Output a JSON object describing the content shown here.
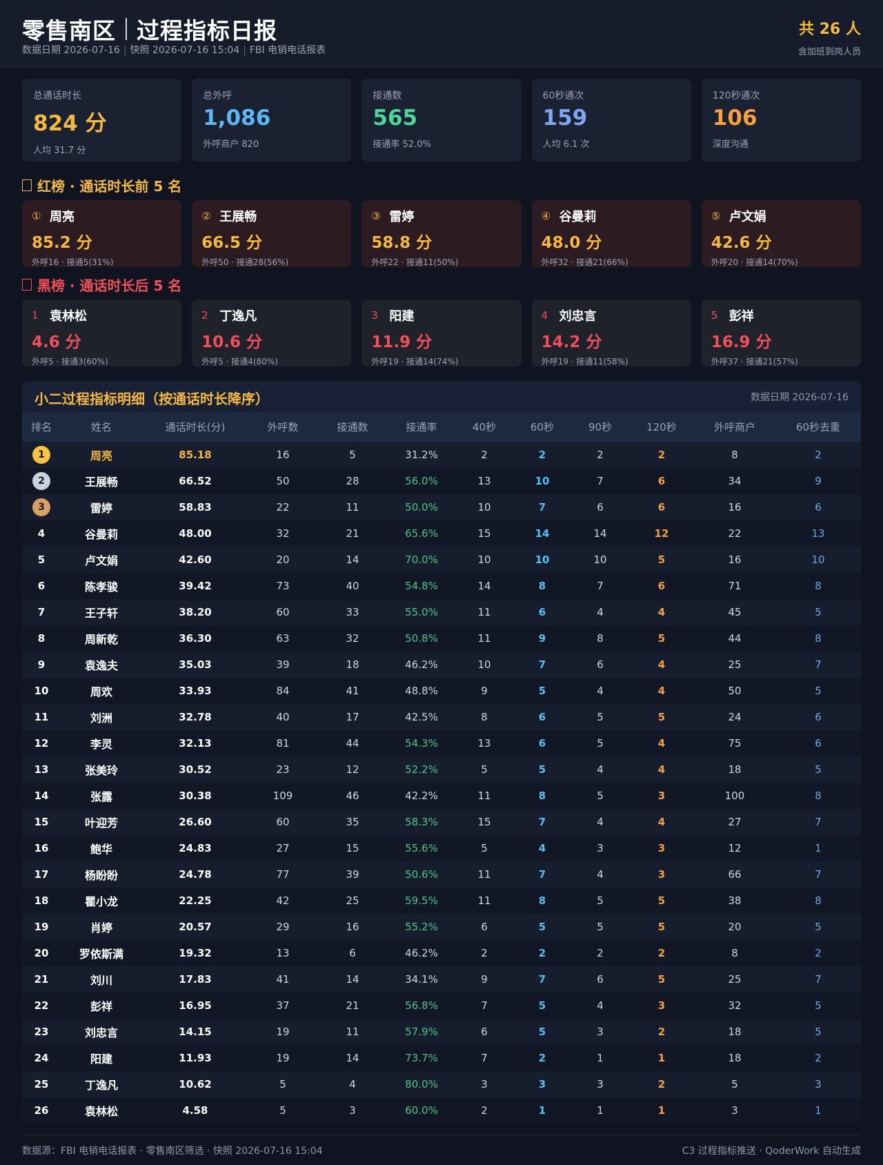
{
  "header": {
    "title_region": "零售南区",
    "title_report": "过程指标日报",
    "subtitle_parts": [
      "数据日期 2026-07-16",
      "快照 2026-07-16 15:04",
      "FBI 电销电话报表"
    ],
    "count": "共 26 人",
    "count_note": "含加班到岗人员"
  },
  "kpis": [
    {
      "label": "总通话时长",
      "value": "824 分",
      "sub": "人均 31.7 分",
      "color": "#f5b93f"
    },
    {
      "label": "总外呼",
      "value": "1,086",
      "sub": "外呼商户 820",
      "color": "#5cb8f5"
    },
    {
      "label": "接通数",
      "value": "565",
      "sub": "接通率 52.0%",
      "color": "#4cd69a"
    },
    {
      "label": "60秒通次",
      "value": "159",
      "sub": "人均 6.1 次",
      "color": "#7fa6f0"
    },
    {
      "label": "120秒通次",
      "value": "106",
      "sub": "深度沟通",
      "color": "#f5a13f"
    }
  ],
  "red_board": {
    "title": "红榜 · 通话时长前 5 名",
    "color": "#f5b93f",
    "items": [
      {
        "num": "①",
        "name": "周亮",
        "value": "85.2 分",
        "sub": "外呼16 · 接通5(31%)"
      },
      {
        "num": "②",
        "name": "王展畅",
        "value": "66.5 分",
        "sub": "外呼50 · 接通28(56%)"
      },
      {
        "num": "③",
        "name": "雷婷",
        "value": "58.8 分",
        "sub": "外呼22 · 接通11(50%)"
      },
      {
        "num": "④",
        "name": "谷曼莉",
        "value": "48.0 分",
        "sub": "外呼32 · 接通21(66%)"
      },
      {
        "num": "⑤",
        "name": "卢文娟",
        "value": "42.6 分",
        "sub": "外呼20 · 接通14(70%)"
      }
    ]
  },
  "black_board": {
    "title": "黑榜 · 通话时长后 5 名",
    "color": "#f0505a",
    "items": [
      {
        "num": "1",
        "name": "袁林松",
        "value": "4.6 分",
        "sub": "外呼5 · 接通3(60%)"
      },
      {
        "num": "2",
        "name": "丁逸凡",
        "value": "10.6 分",
        "sub": "外呼5 · 接通4(80%)"
      },
      {
        "num": "3",
        "name": "阳建",
        "value": "11.9 分",
        "sub": "外呼19 · 接通14(74%)"
      },
      {
        "num": "4",
        "name": "刘忠言",
        "value": "14.2 分",
        "sub": "外呼19 · 接通11(58%)"
      },
      {
        "num": "5",
        "name": "彭祥",
        "value": "16.9 分",
        "sub": "外呼37 · 接通21(57%)"
      }
    ]
  },
  "table": {
    "title": "小二过程指标明细（按通话时长降序）",
    "date": "数据日期 2026-07-16",
    "medal_colors": [
      "#f5c242",
      "#c9d3de",
      "#d9a066"
    ],
    "columns": [
      "排名",
      "姓名",
      "通话时长(分)",
      "外呼数",
      "接通数",
      "接通率",
      "40秒",
      "60秒",
      "90秒",
      "120秒",
      "外呼商户",
      "60秒去重"
    ],
    "rows": [
      [
        "1",
        "周亮",
        "85.18",
        "16",
        "5",
        "31.2%",
        "2",
        "2",
        "2",
        "2",
        "8",
        "2"
      ],
      [
        "2",
        "王展畅",
        "66.52",
        "50",
        "28",
        "56.0%",
        "13",
        "10",
        "7",
        "6",
        "34",
        "9"
      ],
      [
        "3",
        "雷婷",
        "58.83",
        "22",
        "11",
        "50.0%",
        "10",
        "7",
        "6",
        "6",
        "16",
        "6"
      ],
      [
        "4",
        "谷曼莉",
        "48.00",
        "32",
        "21",
        "65.6%",
        "15",
        "14",
        "14",
        "12",
        "22",
        "13"
      ],
      [
        "5",
        "卢文娟",
        "42.60",
        "20",
        "14",
        "70.0%",
        "10",
        "10",
        "10",
        "5",
        "16",
        "10"
      ],
      [
        "6",
        "陈孝骏",
        "39.42",
        "73",
        "40",
        "54.8%",
        "14",
        "8",
        "7",
        "6",
        "71",
        "8"
      ],
      [
        "7",
        "王子轩",
        "38.20",
        "60",
        "33",
        "55.0%",
        "11",
        "6",
        "4",
        "4",
        "45",
        "5"
      ],
      [
        "8",
        "周新乾",
        "36.30",
        "63",
        "32",
        "50.8%",
        "11",
        "9",
        "8",
        "5",
        "44",
        "8"
      ],
      [
        "9",
        "袁逸夫",
        "35.03",
        "39",
        "18",
        "46.2%",
        "10",
        "7",
        "6",
        "4",
        "25",
        "7"
      ],
      [
        "10",
        "周欢",
        "33.93",
        "84",
        "41",
        "48.8%",
        "9",
        "5",
        "4",
        "4",
        "50",
        "5"
      ],
      [
        "11",
        "刘洲",
        "32.78",
        "40",
        "17",
        "42.5%",
        "8",
        "6",
        "5",
        "5",
        "24",
        "6"
      ],
      [
        "12",
        "李灵",
        "32.13",
        "81",
        "44",
        "54.3%",
        "13",
        "6",
        "5",
        "4",
        "75",
        "6"
      ],
      [
        "13",
        "张美玲",
        "30.52",
        "23",
        "12",
        "52.2%",
        "5",
        "5",
        "4",
        "4",
        "18",
        "5"
      ],
      [
        "14",
        "张露",
        "30.38",
        "109",
        "46",
        "42.2%",
        "11",
        "8",
        "5",
        "3",
        "100",
        "8"
      ],
      [
        "15",
        "叶迎芳",
        "26.60",
        "60",
        "35",
        "58.3%",
        "15",
        "7",
        "4",
        "4",
        "27",
        "7"
      ],
      [
        "16",
        "鲍华",
        "24.83",
        "27",
        "15",
        "55.6%",
        "5",
        "4",
        "3",
        "3",
        "12",
        "1"
      ],
      [
        "17",
        "杨盼盼",
        "24.78",
        "77",
        "39",
        "50.6%",
        "11",
        "7",
        "4",
        "3",
        "66",
        "7"
      ],
      [
        "18",
        "瞿小龙",
        "22.25",
        "42",
        "25",
        "59.5%",
        "11",
        "8",
        "5",
        "5",
        "38",
        "8"
      ],
      [
        "19",
        "肖婷",
        "20.57",
        "29",
        "16",
        "55.2%",
        "6",
        "5",
        "5",
        "5",
        "20",
        "5"
      ],
      [
        "20",
        "罗依斯满",
        "19.32",
        "13",
        "6",
        "46.2%",
        "2",
        "2",
        "2",
        "2",
        "8",
        "2"
      ],
      [
        "21",
        "刘川",
        "17.83",
        "41",
        "14",
        "34.1%",
        "9",
        "7",
        "6",
        "5",
        "25",
        "7"
      ],
      [
        "22",
        "彭祥",
        "16.95",
        "37",
        "21",
        "56.8%",
        "7",
        "5",
        "4",
        "3",
        "32",
        "5"
      ],
      [
        "23",
        "刘忠言",
        "14.15",
        "19",
        "11",
        "57.9%",
        "6",
        "5",
        "3",
        "2",
        "18",
        "5"
      ],
      [
        "24",
        "阳建",
        "11.93",
        "19",
        "14",
        "73.7%",
        "7",
        "2",
        "1",
        "1",
        "18",
        "2"
      ],
      [
        "25",
        "丁逸凡",
        "10.62",
        "5",
        "4",
        "80.0%",
        "3",
        "3",
        "3",
        "2",
        "5",
        "3"
      ],
      [
        "26",
        "袁林松",
        "4.58",
        "5",
        "3",
        "60.0%",
        "2",
        "1",
        "1",
        "1",
        "3",
        "1"
      ]
    ]
  },
  "footer": {
    "left": "数据源：FBI 电销电话报表 · 零售南区筛选 · 快照 2026-07-16 15:04",
    "right": "C3 过程指标推送 · QoderWork 自动生成"
  }
}
